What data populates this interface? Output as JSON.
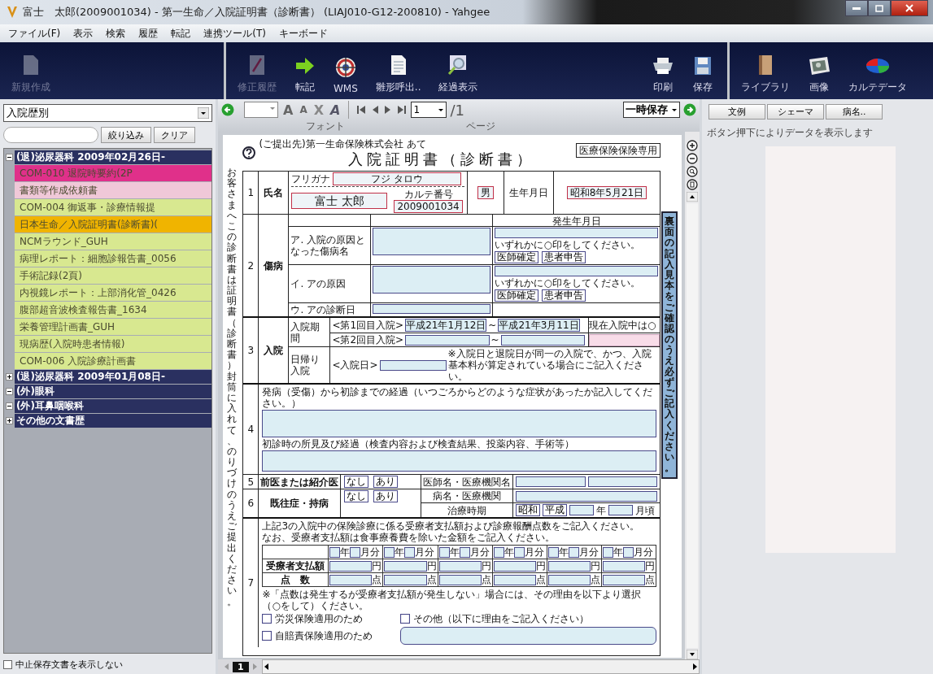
{
  "window": {
    "title": "富士　太郎(2009001034) - 第一生命／入院証明書（診断書） (LIAJ010-G12-200810) - Yahgee"
  },
  "menu": [
    "ファイル(F)",
    "表示",
    "検索",
    "履歴",
    "転記",
    "連携ツール(T)",
    "キーボード"
  ],
  "left_toolbar": [
    {
      "label": "新規作成",
      "kind": "doc",
      "disabled": true
    }
  ],
  "main_toolbar": {
    "left": [
      {
        "label": "修正履歴",
        "kind": "pen",
        "disabled": true
      },
      {
        "label": "転記",
        "kind": "arrow",
        "disabled": false
      },
      {
        "label": "WMS",
        "kind": "wheel",
        "disabled": false
      },
      {
        "label": "雛形呼出..",
        "kind": "page",
        "disabled": false
      },
      {
        "label": "経過表示",
        "kind": "lens",
        "disabled": false
      }
    ],
    "right": [
      {
        "label": "印刷",
        "kind": "printer",
        "disabled": false
      },
      {
        "label": "保存",
        "kind": "floppy",
        "disabled": false
      }
    ]
  },
  "right_toolbar": [
    {
      "label": "ライブラリ",
      "kind": "book",
      "disabled": false
    },
    {
      "label": "画像",
      "kind": "photo",
      "disabled": false
    },
    {
      "label": "カルテデータ",
      "kind": "pie",
      "disabled": false
    }
  ],
  "history_view": {
    "value": "入院歴別"
  },
  "filter_buttons": [
    "絞り込み",
    "クリア"
  ],
  "tree": [
    {
      "label": "(退)泌尿器科 2009年02月26日-",
      "expanded": true,
      "children": [
        {
          "label": "COM-010 退院時要約(2P",
          "color": "#e0308a"
        },
        {
          "label": "書類等作成依頼書",
          "color": "#f0c8d8"
        },
        {
          "label": "COM-004 御返事・診療情報提",
          "color": "#d8e890"
        },
        {
          "label": "日本生命／入院証明書(診断書)(",
          "color": "#f0b400"
        },
        {
          "label": "NCMラウンド_GUH",
          "color": "#d8e890"
        },
        {
          "label": "病理レポート：細胞診報告書_0056",
          "color": "#d8e890"
        },
        {
          "label": "手術記録(2頁)",
          "color": "#d8e890"
        },
        {
          "label": "内視鏡レポート：上部消化管_0426",
          "color": "#d8e890"
        },
        {
          "label": "腹部超音波検査報告書_1634",
          "color": "#d8e890"
        },
        {
          "label": "栄養管理計画書_GUH",
          "color": "#d8e890"
        },
        {
          "label": "現病歴(入院時患者情報)",
          "color": "#d8e890"
        },
        {
          "label": "COM-006 入院診療計画書",
          "color": "#d8e890"
        }
      ]
    },
    {
      "label": "(退)泌尿器科 2009年01月08日-",
      "expanded": false
    },
    {
      "label": "(外)眼科",
      "expanded": true
    },
    {
      "label": "(外)耳鼻咽喉科",
      "expanded": true
    },
    {
      "label": "その他の文書歴",
      "expanded": false
    }
  ],
  "hide_stopped": {
    "label": "中止保存文書を表示しない",
    "checked": false
  },
  "format_bar": {
    "font_buttons": [
      {
        "glyph": "A",
        "kind": "grow"
      },
      {
        "glyph": "A",
        "kind": "shrink"
      },
      {
        "glyph": "X",
        "kind": "clear"
      },
      {
        "glyph": "A",
        "kind": "color"
      }
    ],
    "font_group": "フォント",
    "page": "1",
    "page_total": "/1",
    "page_group": "ページ",
    "save_mode": "一時保存"
  },
  "form": {
    "addressee": "(ご提出先)第一生命保険株式会社 あて",
    "title": "入院証明書（診断書）",
    "badge": "医療保険保険専用",
    "side_note": "お客さまへこの診断書は証明書（診断書）封筒に入れて、のりづけのうえご提出ください。",
    "strip_note": "裏面の記入見本をご確認のうえ必ずご記入ください。",
    "s1": {
      "number": "1",
      "label": "氏名",
      "furigana_label": "フリガナ",
      "furigana": "フジ タロウ",
      "name": "富士 太郎",
      "chart_label": "カルテ番号",
      "chart_no": "2009001034",
      "sex": "男",
      "dob_label": "生年月日",
      "dob": "昭和8年5月21日"
    },
    "s2": {
      "number": "2",
      "label": "傷病",
      "onset_label": "発生年月日",
      "rows": [
        {
          "label": "ア. 入院の原因となった傷病名",
          "note": "いずれかに○印をしてください。",
          "options": [
            "医師確定",
            "患者申告"
          ]
        },
        {
          "label": "イ. アの原因",
          "note": "いずれかに○印をしてください。",
          "options": [
            "医師確定",
            "患者申告"
          ]
        },
        {
          "label": "ウ. アの診断日"
        }
      ]
    },
    "s3": {
      "number": "3",
      "label": "入院",
      "period_label": "入院期間",
      "rows": [
        {
          "label": "<第1回目入院>",
          "from": "平成21年1月12日",
          "sep": "~",
          "to": "平成21年3月11日"
        },
        {
          "label": "<第2回目入院>",
          "sep": "~"
        }
      ],
      "still_note": "現在入院中は○",
      "day_label": "日帰り入院",
      "day_row_label": "<入院日>",
      "day_note": "※入院日と退院日が同一の入院で、かつ、入院基本料が算定されている場合にご記入ください。"
    },
    "s4": {
      "number": "4",
      "prompt1": "発病（受傷）から初診までの経過（いつごろからどのような症状があったか記入してください。）",
      "prompt2": "初診時の所見及び経過（検査内容および検査結果、投薬内容、手術等）"
    },
    "s5": {
      "number": "5",
      "label": "前医または紹介医",
      "options": [
        "なし",
        "あり"
      ],
      "target": "医師名・医療機関名"
    },
    "s6": {
      "number": "6",
      "label": "既往症・持病",
      "options": [
        "なし",
        "あり"
      ],
      "target": "病名・医療機関",
      "period": "治療時期",
      "eras": [
        "昭和",
        "平成"
      ],
      "year": "年",
      "month": "月頃"
    },
    "s7": {
      "number": "7",
      "intro": [
        "上記3の入院中の保険診療に係る受療者支払額および診療報酬点数をご記入ください。",
        "なお、受療者支払額は食事療養費を除いた金額をご記入ください。"
      ],
      "row_labels": [
        "受療者支払額",
        "点　数"
      ],
      "months": [
        {
          "year": "年",
          "month": "月分",
          "yen": "円",
          "points": "点"
        },
        {
          "year": "年",
          "month": "月分",
          "yen": "円",
          "points": "点"
        },
        {
          "year": "年",
          "month": "月分",
          "yen": "円",
          "points": "点"
        },
        {
          "year": "年",
          "month": "月分",
          "yen": "円",
          "points": "点"
        },
        {
          "year": "年",
          "month": "月分",
          "yen": "円",
          "points": "点"
        },
        {
          "year": "年",
          "month": "月分",
          "yen": "円",
          "points": "点"
        }
      ],
      "reason_note": "※「点数は発生するが受療者支払額が発生しない」場合には、その理由を以下より選択（○をして）ください。",
      "reasons": [
        {
          "label": "労災保険適用のため",
          "checked": false
        },
        {
          "label": "その他（以下に理由をご記入ください）",
          "checked": false
        },
        {
          "label": "自賠責保険適用のため",
          "checked": false
        }
      ]
    }
  },
  "sheet_tab": "1",
  "side_panel": {
    "buttons": [
      "文例",
      "シェーマ",
      "病名.."
    ],
    "message": "ボタン押下によりデータを表示します"
  }
}
